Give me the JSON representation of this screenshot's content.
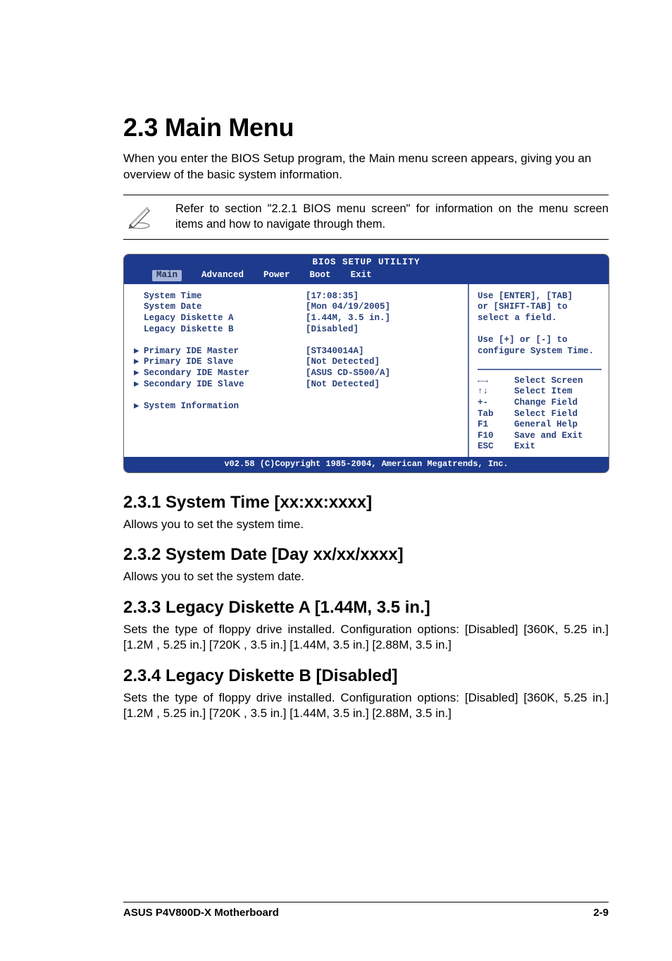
{
  "heading": "2.3   Main Menu",
  "intro": "When you enter the BIOS Setup program, the Main menu screen appears, giving you an overview of the basic system information.",
  "note": "Refer to section \"2.2.1  BIOS menu screen\" for information on the menu screen items and how to navigate through them.",
  "bios": {
    "title": "BIOS SETUP UTILITY",
    "tabs": [
      "Main",
      "Advanced",
      "Power",
      "Boot",
      "Exit"
    ],
    "active_tab": "Main",
    "items": [
      {
        "label": "System Time",
        "value": "[17:08:35]",
        "arrow": false
      },
      {
        "label": "System Date",
        "value": "[Mon 04/19/2005]",
        "arrow": false
      },
      {
        "label": "Legacy Diskette A",
        "value": "[1.44M, 3.5 in.]",
        "arrow": false
      },
      {
        "label": "Legacy Diskette B",
        "value": "[Disabled]",
        "arrow": false
      },
      {
        "label": "",
        "value": "",
        "arrow": false
      },
      {
        "label": "Primary IDE Master",
        "value": "[ST340014A]",
        "arrow": true
      },
      {
        "label": "Primary IDE Slave",
        "value": "[Not Detected]",
        "arrow": true
      },
      {
        "label": "Secondary IDE Master",
        "value": "[ASUS   CD-S500/A]",
        "arrow": true
      },
      {
        "label": "Secondary IDE Slave",
        "value": "[Not Detected]",
        "arrow": true
      },
      {
        "label": "",
        "value": "",
        "arrow": false
      },
      {
        "label": "System Information",
        "value": "",
        "arrow": true
      }
    ],
    "help_top": [
      "Use [ENTER], [TAB]",
      "or [SHIFT-TAB] to",
      "select a field.",
      "",
      "Use [+] or [-] to",
      "configure System Time."
    ],
    "nav": [
      {
        "key": "←→",
        "action": "Select Screen"
      },
      {
        "key": "↑↓",
        "action": "Select Item"
      },
      {
        "key": "+-",
        "action": "Change Field"
      },
      {
        "key": "Tab",
        "action": "Select Field"
      },
      {
        "key": "F1",
        "action": "General Help"
      },
      {
        "key": "F10",
        "action": "Save and Exit"
      },
      {
        "key": "ESC",
        "action": "Exit"
      }
    ],
    "footer": "v02.58 (C)Copyright 1985-2004, American Megatrends, Inc."
  },
  "sections": [
    {
      "title": "2.3.1   System Time [xx:xx:xxxx]",
      "body": "Allows you to set the system time."
    },
    {
      "title": "2.3.2   System Date [Day xx/xx/xxxx]",
      "body": "Allows you to set the system date."
    },
    {
      "title": "2.3.3   Legacy Diskette A [1.44M, 3.5 in.]",
      "body": "Sets the type of floppy drive installed. Configuration options: [Disabled] [360K, 5.25 in.] [1.2M , 5.25 in.] [720K , 3.5 in.] [1.44M, 3.5 in.] [2.88M, 3.5 in.]"
    },
    {
      "title": "2.3.4   Legacy Diskette B [Disabled]",
      "body": "Sets the type of floppy drive installed. Configuration options: [Disabled] [360K, 5.25 in.] [1.2M , 5.25 in.] [720K , 3.5 in.] [1.44M, 3.5 in.] [2.88M, 3.5 in.]"
    }
  ],
  "footer_left": "ASUS P4V800D-X Motherboard",
  "footer_right": "2-9"
}
